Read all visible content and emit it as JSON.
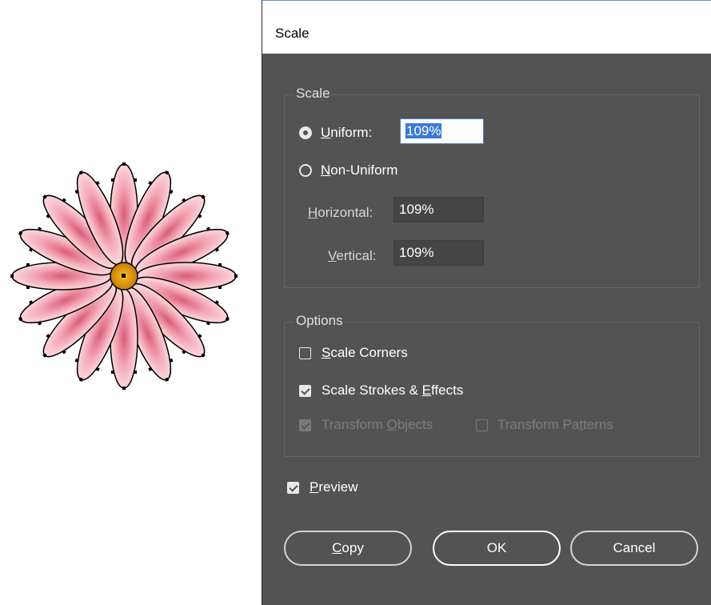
{
  "dialog": {
    "title": "Scale",
    "scale_group": {
      "label": "Scale",
      "uniform": {
        "label_u": "U",
        "label_rest": "niform:",
        "checked": true,
        "value": "109%"
      },
      "non_uniform": {
        "label_u": "N",
        "label_rest": "on-Uniform",
        "checked": false
      },
      "horizontal": {
        "label_u": "H",
        "label_rest": "orizontal:",
        "value": "109%"
      },
      "vertical": {
        "label_u": "V",
        "label_rest": "ertical:",
        "value": "109%"
      }
    },
    "options_group": {
      "label": "Options",
      "scale_corners": {
        "label_u": "S",
        "label_rest": "cale Corners",
        "checked": false
      },
      "scale_strokes": {
        "label_pre": "Scale Strokes & ",
        "label_u": "E",
        "label_rest": "ffects",
        "checked": true
      },
      "transform_objects": {
        "label_pre": "Transform ",
        "label_u": "O",
        "label_rest": "bjects",
        "checked": true,
        "enabled": false
      },
      "transform_patterns": {
        "label_pre": "Transform Pa",
        "label_u": "t",
        "label_rest": "terns",
        "checked": false,
        "enabled": false
      }
    },
    "preview": {
      "label_u": "P",
      "label_rest": "review",
      "checked": true
    },
    "buttons": {
      "copy": {
        "label_u": "C",
        "label_rest": "opy"
      },
      "ok": "OK",
      "cancel": "Cancel"
    }
  },
  "colors": {
    "dialog_bg": "#535353",
    "accent": "#3a79d6",
    "petal": "#f2a0b0",
    "flower_center": "#e6a012"
  },
  "icons": [
    "flower-artwork",
    "radio-icon",
    "checkbox-icon"
  ]
}
